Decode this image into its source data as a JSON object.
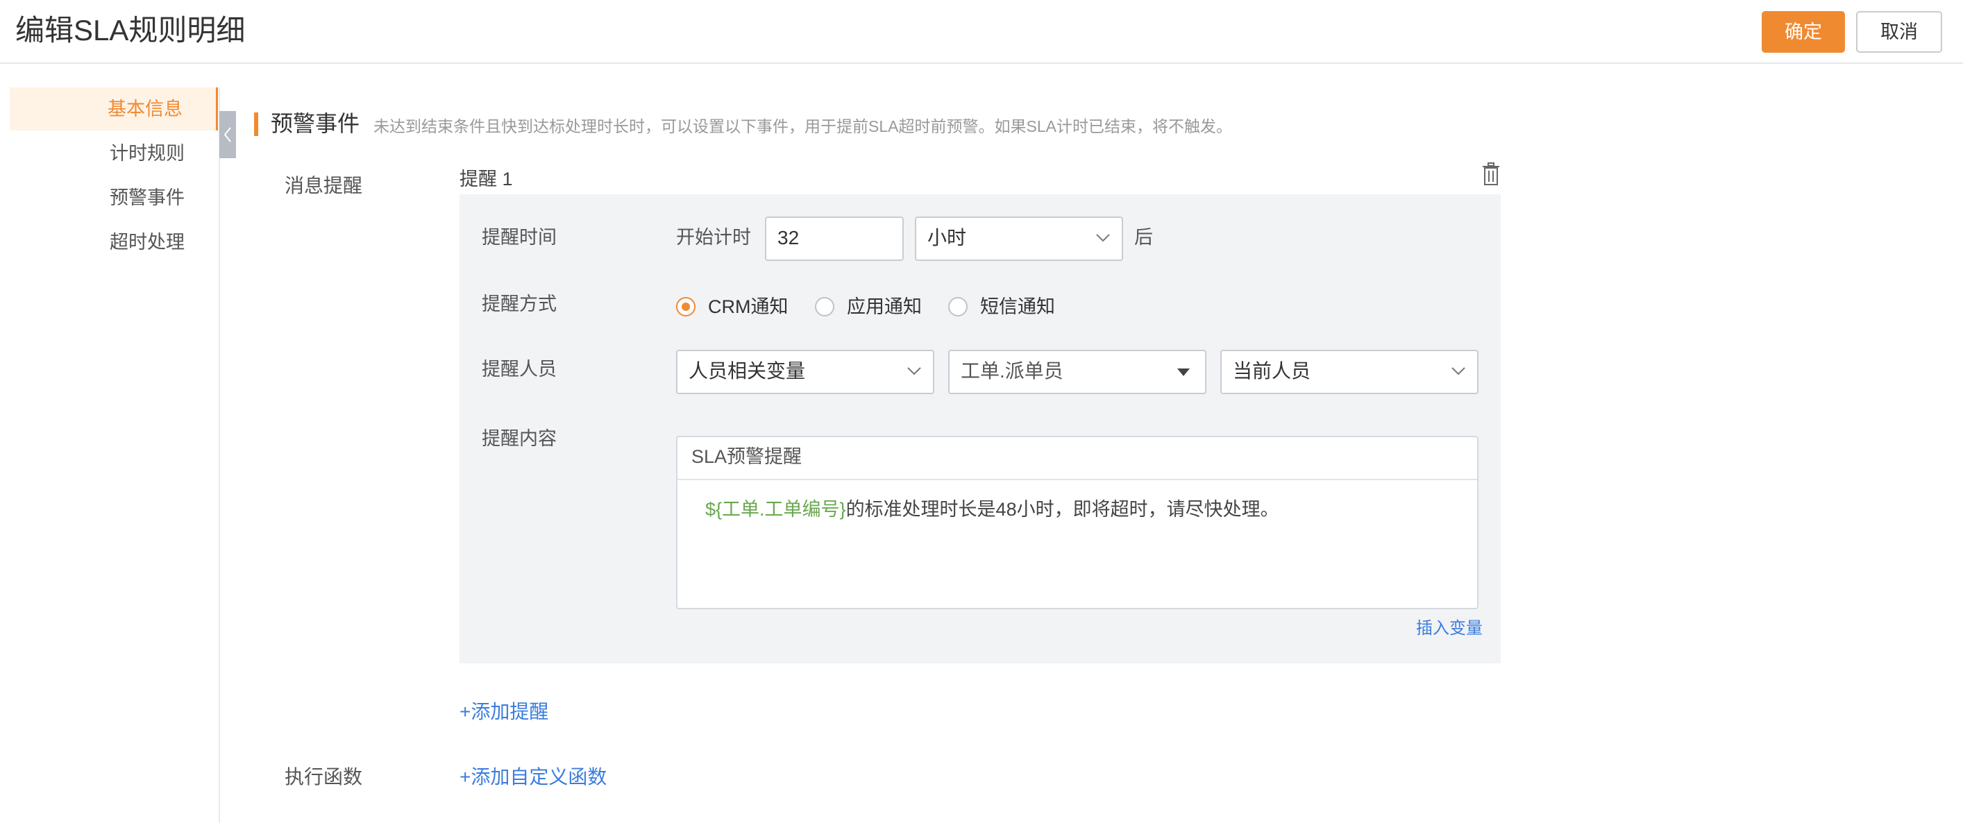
{
  "header": {
    "title": "编辑SLA规则明细",
    "confirm_label": "确定",
    "cancel_label": "取消"
  },
  "nav": {
    "items": [
      {
        "label": "基本信息",
        "active": true
      },
      {
        "label": "计时规则",
        "active": false
      },
      {
        "label": "预警事件",
        "active": false
      },
      {
        "label": "超时处理",
        "active": false
      }
    ]
  },
  "section": {
    "title": "预警事件",
    "description": "未达到结束条件且快到达标处理时长时，可以设置以下事件，用于提前SLA超时前预警。如果SLA计时已结束，将不触发。"
  },
  "message_reminder": {
    "label": "消息提醒",
    "card_title": "提醒 1",
    "time": {
      "label": "提醒时间",
      "prefix": "开始计时",
      "value": "32",
      "unit": "小时",
      "suffix": "后"
    },
    "method": {
      "label": "提醒方式",
      "options": [
        {
          "label": "CRM通知",
          "checked": true
        },
        {
          "label": "应用通知",
          "checked": false
        },
        {
          "label": "短信通知",
          "checked": false
        }
      ]
    },
    "recipients": {
      "label": "提醒人员",
      "type": "人员相关变量",
      "field": "工单.派单员",
      "scope": "当前人员"
    },
    "content": {
      "label": "提醒内容",
      "title": "SLA预警提醒",
      "body_variable": "${工单.工单编号}",
      "body_text": "的标准处理时长是48小时，即将超时，请尽快处理。",
      "insert_variable_label": "插入变量"
    },
    "add_reminder_label": "+添加提醒"
  },
  "function": {
    "label": "执行函数",
    "add_label": "+添加自定义函数"
  },
  "colors": {
    "accent": "#f08a31",
    "link": "#3b7ddd",
    "variable": "#6aa84f",
    "card_bg": "#f2f3f5"
  }
}
